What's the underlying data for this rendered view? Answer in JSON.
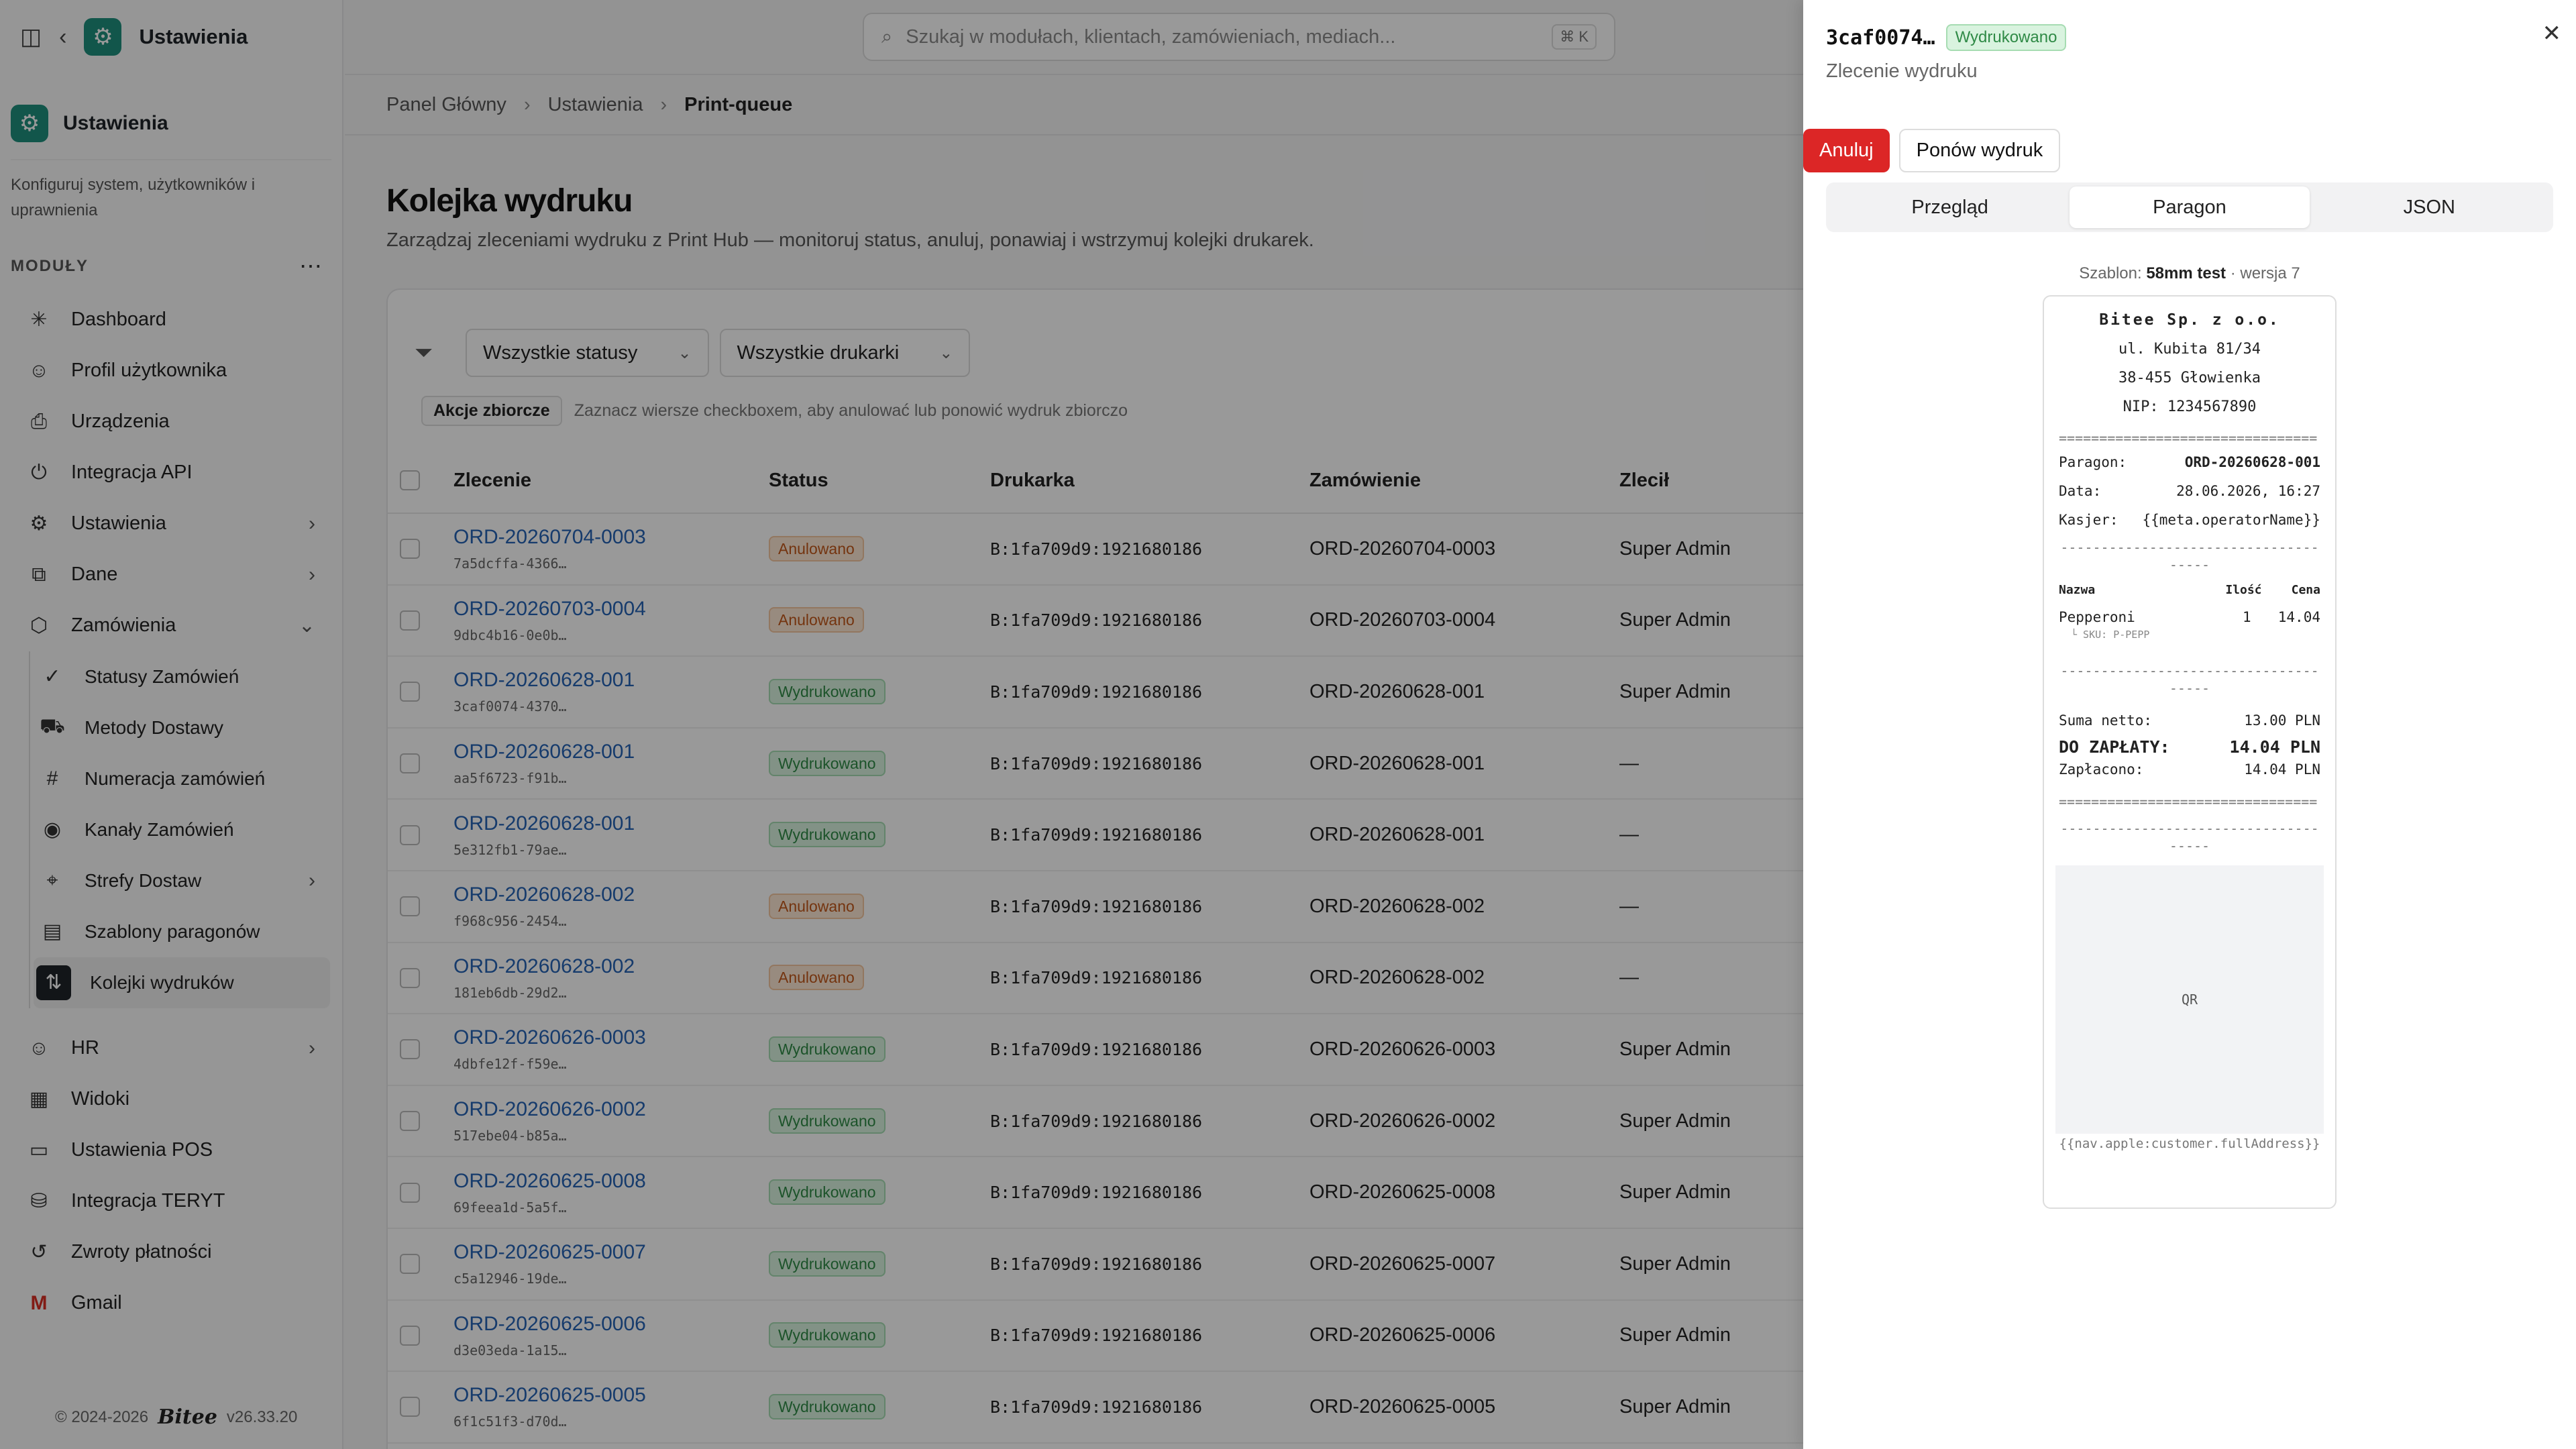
{
  "sidebar": {
    "back_icon": "chevron-left-icon",
    "app_title": "Ustawienia",
    "card_title": "Ustawienia",
    "card_desc": "Konfiguruj system, użytkowników i uprawnienia",
    "section_label": "MODUŁY",
    "items": [
      {
        "label": "Dashboard",
        "icon": "sparkle-icon"
      },
      {
        "label": "Profil użytkownika",
        "icon": "user-icon"
      },
      {
        "label": "Urządzenia",
        "icon": "printer-icon"
      },
      {
        "label": "Integracja API",
        "icon": "plug-icon"
      },
      {
        "label": "Ustawienia",
        "icon": "gear-icon"
      },
      {
        "label": "Dane",
        "icon": "data-icon"
      },
      {
        "label": "Zamówienia",
        "icon": "box-icon"
      }
    ],
    "subitems": [
      {
        "label": "Statusy Zamówień",
        "icon": "check-circle-icon"
      },
      {
        "label": "Metody Dostawy",
        "icon": "truck-icon"
      },
      {
        "label": "Numeracja zamówień",
        "icon": "hash-icon"
      },
      {
        "label": "Kanały Zamówień",
        "icon": "broadcast-icon"
      },
      {
        "label": "Strefy Dostaw",
        "icon": "map-pin-icon"
      },
      {
        "label": "Szablony paragonów",
        "icon": "receipt-icon"
      },
      {
        "label": "Kolejki wydruków",
        "icon": "queue-icon"
      }
    ],
    "items2": [
      {
        "label": "HR",
        "icon": "person-icon"
      },
      {
        "label": "Widoki",
        "icon": "layout-icon"
      },
      {
        "label": "Ustawienia POS",
        "icon": "monitor-icon"
      },
      {
        "label": "Integracja TERYT",
        "icon": "database-icon"
      },
      {
        "label": "Zwroty płatności",
        "icon": "refund-icon"
      },
      {
        "label": "Gmail",
        "icon": "gmail-icon"
      }
    ],
    "footer_copy": "© 2024-2026",
    "footer_logo": "Bitee",
    "footer_version": "v26.33.20"
  },
  "search": {
    "placeholder": "Szukaj w modułach, klientach, zamówieniach, mediach...",
    "shortcut": "⌘ K"
  },
  "breadcrumb": [
    "Panel Główny",
    "Ustawienia",
    "Print-queue"
  ],
  "page": {
    "title": "Kolejka wydruku",
    "description": "Zarządzaj zleceniami wydruku z Print Hub — monitoruj status, anuluj, ponawiaj i wstrzymuj kolejki drukarek."
  },
  "filters": {
    "status": "Wszystkie statusy",
    "printer": "Wszystkie drukarki"
  },
  "bulk": {
    "button": "Akcje zbiorcze",
    "hint": "Zaznacz wiersze checkboxem, aby anulować lub ponowić wydruk zbiorczo"
  },
  "table": {
    "headers": [
      "Zlecenie",
      "Status",
      "Drukarka",
      "Zamówienie",
      "Zlecił"
    ],
    "rows": [
      {
        "order": "ORD-20260704-0003",
        "id": "7a5dcffa-4366…",
        "status": "Anulowano",
        "kind": "ann",
        "printer": "B:1fa709d9:1921680186",
        "zam": "ORD-20260704-0003",
        "by": "Super Admin"
      },
      {
        "order": "ORD-20260703-0004",
        "id": "9dbc4b16-0e0b…",
        "status": "Anulowano",
        "kind": "ann",
        "printer": "B:1fa709d9:1921680186",
        "zam": "ORD-20260703-0004",
        "by": "Super Admin"
      },
      {
        "order": "ORD-20260628-001",
        "id": "3caf0074-4370…",
        "status": "Wydrukowano",
        "kind": "wyd",
        "printer": "B:1fa709d9:1921680186",
        "zam": "ORD-20260628-001",
        "by": "Super Admin"
      },
      {
        "order": "ORD-20260628-001",
        "id": "aa5f6723-f91b…",
        "status": "Wydrukowano",
        "kind": "wyd",
        "printer": "B:1fa709d9:1921680186",
        "zam": "ORD-20260628-001",
        "by": "—"
      },
      {
        "order": "ORD-20260628-001",
        "id": "5e312fb1-79ae…",
        "status": "Wydrukowano",
        "kind": "wyd",
        "printer": "B:1fa709d9:1921680186",
        "zam": "ORD-20260628-001",
        "by": "—"
      },
      {
        "order": "ORD-20260628-002",
        "id": "f968c956-2454…",
        "status": "Anulowano",
        "kind": "ann",
        "printer": "B:1fa709d9:1921680186",
        "zam": "ORD-20260628-002",
        "by": "—"
      },
      {
        "order": "ORD-20260628-002",
        "id": "181eb6db-29d2…",
        "status": "Anulowano",
        "kind": "ann",
        "printer": "B:1fa709d9:1921680186",
        "zam": "ORD-20260628-002",
        "by": "—"
      },
      {
        "order": "ORD-20260626-0003",
        "id": "4dbfe12f-f59e…",
        "status": "Wydrukowano",
        "kind": "wyd",
        "printer": "B:1fa709d9:1921680186",
        "zam": "ORD-20260626-0003",
        "by": "Super Admin"
      },
      {
        "order": "ORD-20260626-0002",
        "id": "517ebe04-b85a…",
        "status": "Wydrukowano",
        "kind": "wyd",
        "printer": "B:1fa709d9:1921680186",
        "zam": "ORD-20260626-0002",
        "by": "Super Admin"
      },
      {
        "order": "ORD-20260625-0008",
        "id": "69feea1d-5a5f…",
        "status": "Wydrukowano",
        "kind": "wyd",
        "printer": "B:1fa709d9:1921680186",
        "zam": "ORD-20260625-0008",
        "by": "Super Admin"
      },
      {
        "order": "ORD-20260625-0007",
        "id": "c5a12946-19de…",
        "status": "Wydrukowano",
        "kind": "wyd",
        "printer": "B:1fa709d9:1921680186",
        "zam": "ORD-20260625-0007",
        "by": "Super Admin"
      },
      {
        "order": "ORD-20260625-0006",
        "id": "d3e03eda-1a15…",
        "status": "Wydrukowano",
        "kind": "wyd",
        "printer": "B:1fa709d9:1921680186",
        "zam": "ORD-20260625-0006",
        "by": "Super Admin"
      },
      {
        "order": "ORD-20260625-0005",
        "id": "6f1c51f3-d70d…",
        "status": "Wydrukowano",
        "kind": "wyd",
        "printer": "B:1fa709d9:1921680186",
        "zam": "ORD-20260625-0005",
        "by": "Super Admin"
      }
    ]
  },
  "drawer": {
    "code": "3caf0074…",
    "status": "Wydrukowano",
    "subtitle": "Zlecenie wydruku",
    "cancel": "Anuluj",
    "reprint": "Ponów wydruk",
    "tabs": [
      "Przegląd",
      "Paragon",
      "JSON"
    ],
    "template_prefix": "Szablon:",
    "template_name": "58mm test",
    "template_version": "· wersja 7"
  },
  "receipt": {
    "company": "Bitee Sp. z o.o.",
    "street": "ul. Kubita 81/34",
    "city": "38-455 Głowienka",
    "nip": "NIP: 1234567890",
    "sep": "================================",
    "dash_sep": "-------------------------------------",
    "rows": [
      {
        "k": "Paragon:",
        "v": "ORD-20260628-001"
      },
      {
        "k": "Data:",
        "v": "28.06.2026, 16:27"
      },
      {
        "k": "Kasjer:",
        "v": "{{meta.operatorName}}"
      }
    ],
    "items_header": [
      "Nazwa",
      "Ilość",
      "Cena"
    ],
    "item": {
      "name": "Pepperoni",
      "qty": "1",
      "price": "14.04",
      "sku": "└ SKU: P-PEPP"
    },
    "netto_label": "Suma netto:",
    "netto_value": "13.00 PLN",
    "total_label": "DO ZAPŁATY:",
    "total_value": "14.04 PLN",
    "paid_label": "Zapłacono:",
    "paid_value": "14.04 PLN",
    "qr": "QR",
    "footer_var": "{{nav.apple:customer.fullAddress}}"
  }
}
